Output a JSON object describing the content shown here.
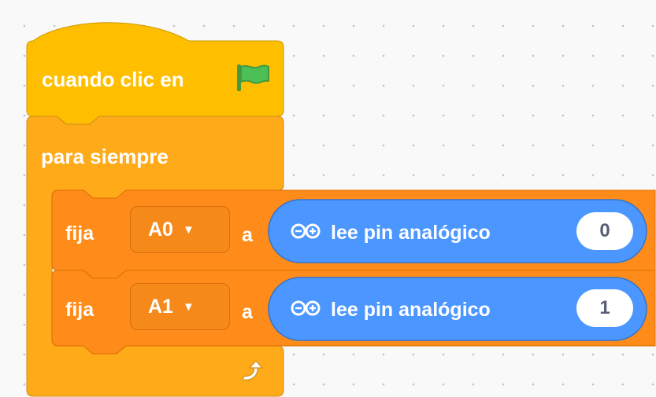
{
  "hat_block": {
    "label": "cuando clic en",
    "icon": "green-flag-icon"
  },
  "forever_block": {
    "label": "para siempre",
    "loop_icon": "loop-arrow-icon"
  },
  "set_blocks": [
    {
      "label": "fija",
      "variable": "A0",
      "to_label": "a",
      "reporter": {
        "icon": "arduino-infinity-icon",
        "label": "lee pin analógico",
        "pin": "0"
      }
    },
    {
      "label": "fija",
      "variable": "A1",
      "to_label": "a",
      "reporter": {
        "icon": "arduino-infinity-icon",
        "label": "lee pin analógico",
        "pin": "1"
      }
    }
  ],
  "colors": {
    "events": "#ffbf00",
    "control": "#ffab19",
    "variables": "#ff8c1a",
    "arduino": "#4c97ff"
  }
}
